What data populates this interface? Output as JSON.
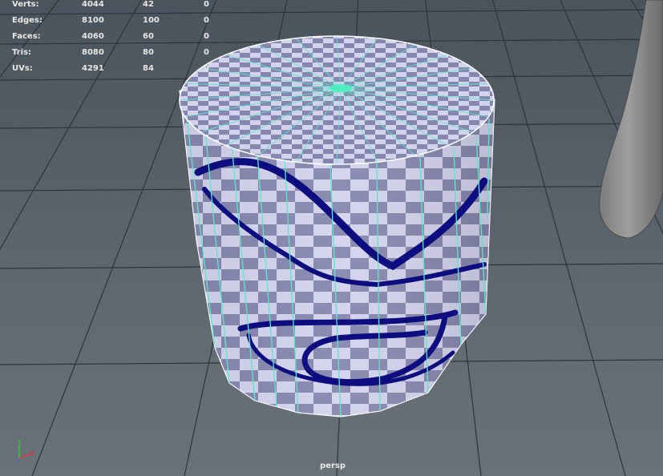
{
  "hud": {
    "rows": [
      {
        "label": "Verts:",
        "total": "4044",
        "selected": "42",
        "extra": "0"
      },
      {
        "label": "Edges:",
        "total": "8100",
        "selected": "100",
        "extra": "0"
      },
      {
        "label": "Faces:",
        "total": "4060",
        "selected": "60",
        "extra": "0"
      },
      {
        "label": "Tris:",
        "total": "8080",
        "selected": "80",
        "extra": "0"
      },
      {
        "label": "UVs:",
        "total": "4291",
        "selected": "84",
        "extra": "0"
      }
    ]
  },
  "camera": {
    "label": "persp"
  },
  "axis": {
    "x_label": "x",
    "y_label": "y",
    "x_color": "#d23c3c",
    "y_color": "#38c838",
    "z_color": "#3c6ed2"
  },
  "colors": {
    "checker_light": "#d4d3ee",
    "checker_dark": "#8687ae",
    "texture_stroke": "#0d0d80",
    "selection_edge": "#5ee6c8",
    "grid_line": "#2e343a",
    "rim_edge": "#ffffff"
  }
}
